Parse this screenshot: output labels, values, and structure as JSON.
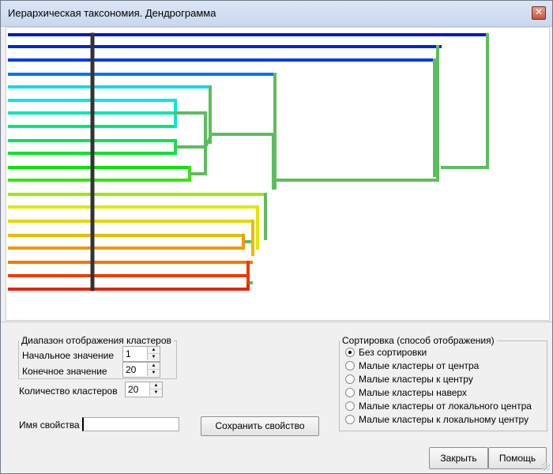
{
  "window": {
    "title": "Иерархическая таксономия. Дендрограмма"
  },
  "colors": {
    "leaf_colors": [
      "#0018cc",
      "#0026dd",
      "#003ae8",
      "#0077ee",
      "#00ddee",
      "#00e8dd",
      "#00e8b5",
      "#00e87e",
      "#00e850",
      "#00e826",
      "#00e800",
      "#33e800",
      "#9ee800",
      "#dfe800",
      "#e8d600",
      "#f0b800",
      "#f09a00",
      "#f07a00",
      "#f03a00",
      "#e82200"
    ],
    "connector_green": "#5dbd5d",
    "bar": "#333333"
  },
  "range_group": {
    "legend": "Диапазон отображения кластеров",
    "start_label": "Начальное значение",
    "start_value": "1",
    "end_label": "Конечное значение",
    "end_value": "20"
  },
  "count_label": "Количество кластеров",
  "count_value": "20",
  "property_label": "Имя свойства",
  "property_value": "",
  "save_button": "Сохранить свойство",
  "sort_group": {
    "legend": "Сортировка (способ отображения)",
    "options": [
      {
        "label": "Без сортировки",
        "selected": true
      },
      {
        "label": "Малые кластеры от центра",
        "selected": false
      },
      {
        "label": "Малые кластеры к центру",
        "selected": false
      },
      {
        "label": "Малые кластеры наверх",
        "selected": false
      },
      {
        "label": "Малые кластеры от локального центра",
        "selected": false
      },
      {
        "label": "Малые кластеры к локальному центру",
        "selected": false
      }
    ]
  },
  "buttons": {
    "close": "Закрыть",
    "help": "Помощь"
  }
}
